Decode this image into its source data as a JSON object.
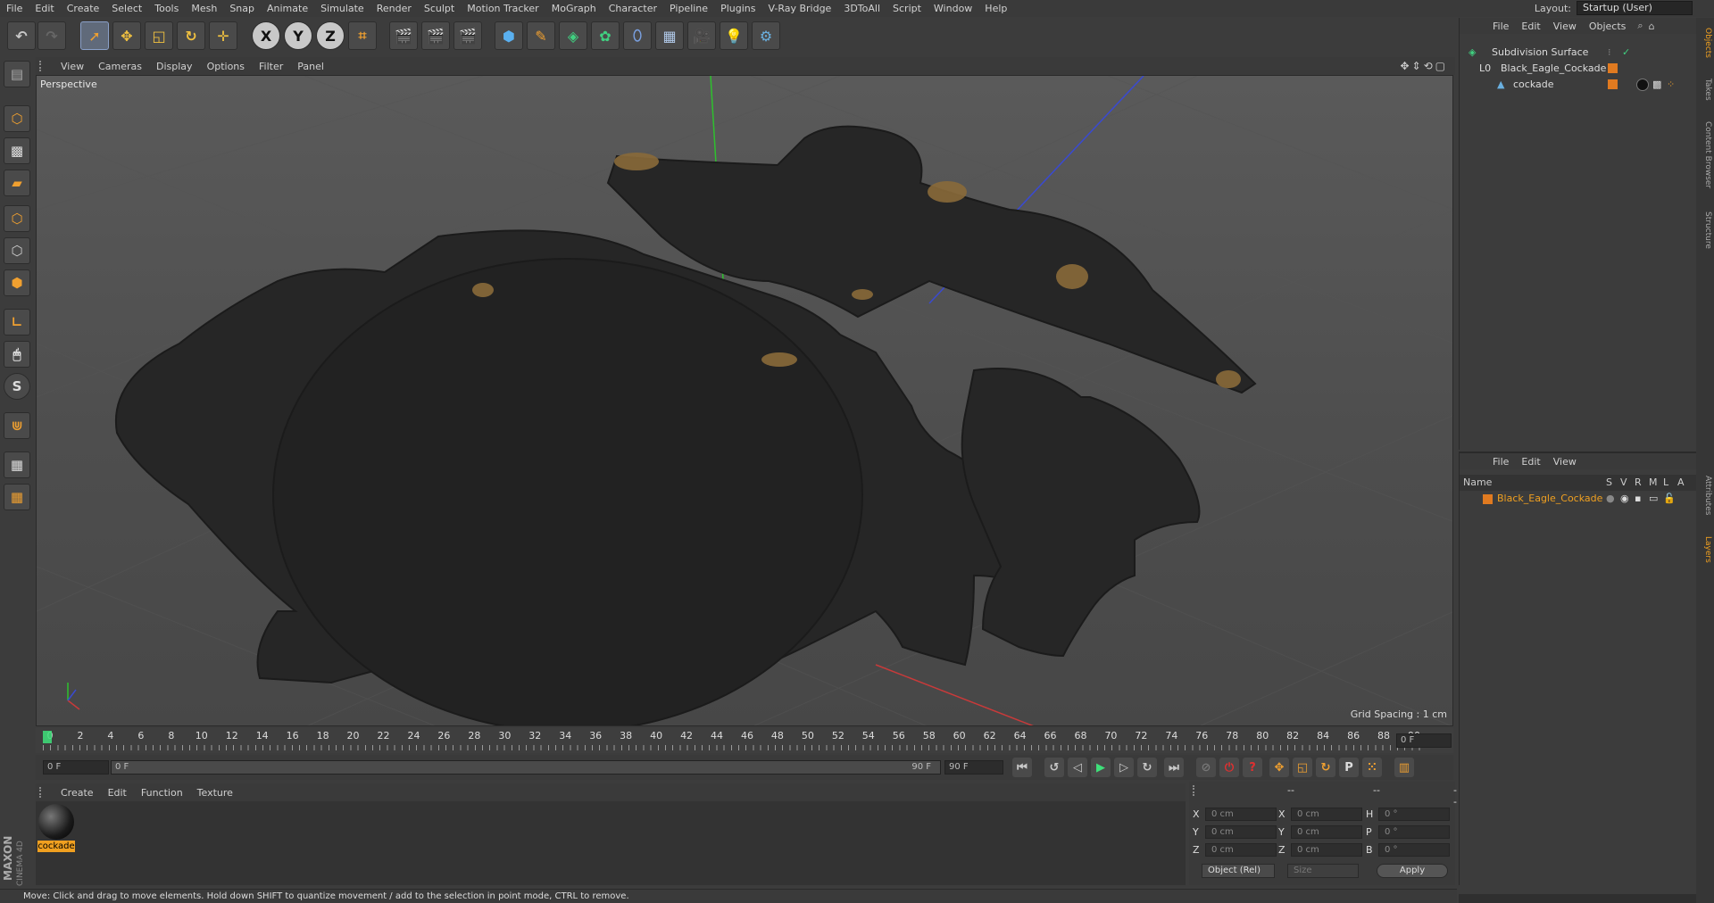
{
  "menu": [
    "File",
    "Edit",
    "Create",
    "Select",
    "Tools",
    "Mesh",
    "Snap",
    "Animate",
    "Simulate",
    "Render",
    "Sculpt",
    "Motion Tracker",
    "MoGraph",
    "Character",
    "Pipeline",
    "Plugins",
    "V-Ray Bridge",
    "3DToAll",
    "Script",
    "Window",
    "Help"
  ],
  "layout": {
    "label": "Layout:",
    "value": "Startup (User)"
  },
  "toolbar": {
    "x": "X",
    "y": "Y",
    "z": "Z"
  },
  "viewport": {
    "menu": [
      "View",
      "Cameras",
      "Display",
      "Options",
      "Filter",
      "Panel"
    ],
    "label": "Perspective",
    "grid_spacing": "Grid Spacing : 1 cm"
  },
  "timeline": {
    "ticks": [
      "0",
      "2",
      "4",
      "6",
      "8",
      "10",
      "12",
      "14",
      "16",
      "18",
      "20",
      "22",
      "24",
      "26",
      "28",
      "30",
      "32",
      "34",
      "36",
      "38",
      "40",
      "42",
      "44",
      "46",
      "48",
      "50",
      "52",
      "54",
      "56",
      "58",
      "60",
      "62",
      "64",
      "66",
      "68",
      "70",
      "72",
      "74",
      "76",
      "78",
      "80",
      "82",
      "84",
      "86",
      "88",
      "90"
    ],
    "current_frame": "0 F",
    "start_field": "0 F",
    "range_start": "0 F",
    "range_end": "90 F",
    "end_field": "90 F"
  },
  "material_panel": {
    "menu": [
      "Create",
      "Edit",
      "Function",
      "Texture"
    ],
    "materials": [
      {
        "name": "cockade"
      }
    ]
  },
  "coordinates": {
    "rows": [
      {
        "axis": "X",
        "pos": "0 cm",
        "axis2": "X",
        "size": "0 cm",
        "axis3": "H",
        "rot": "0 °"
      },
      {
        "axis": "Y",
        "pos": "0 cm",
        "axis2": "Y",
        "size": "0 cm",
        "axis3": "P",
        "rot": "0 °"
      },
      {
        "axis": "Z",
        "pos": "0 cm",
        "axis2": "Z",
        "size": "0 cm",
        "axis3": "B",
        "rot": "0 °"
      }
    ],
    "mode": "Object (Rel)",
    "size_mode": "Size",
    "apply": "Apply",
    "headers": [
      "--",
      "--",
      "--"
    ]
  },
  "status": "Move: Click and drag to move elements. Hold down SHIFT to quantize movement / add to the selection in point mode, CTRL to remove.",
  "object_manager": {
    "menu": [
      "File",
      "Edit",
      "View",
      "Objects"
    ],
    "objects": [
      {
        "name": "Subdivision Surface",
        "level": 0
      },
      {
        "name": "Black_Eagle_Cockade",
        "level": 1
      },
      {
        "name": "cockade",
        "level": 2
      }
    ]
  },
  "layer_manager": {
    "menu": [
      "File",
      "Edit",
      "View"
    ],
    "headers": [
      "Name",
      "S",
      "V",
      "R",
      "M",
      "L",
      "A"
    ],
    "layers": [
      {
        "name": "Black_Eagle_Cockade",
        "color": "#e07a20"
      }
    ]
  },
  "side_tabs": [
    "Objects",
    "Takes",
    "Content Browser",
    "Structure",
    "Attributes",
    "Layers"
  ],
  "brand": {
    "line1": "MAXON",
    "line2": "CINEMA 4D"
  },
  "colors": {
    "accent": "#e07a20",
    "selection": "#ffb000",
    "playhead": "#3ee07a"
  }
}
